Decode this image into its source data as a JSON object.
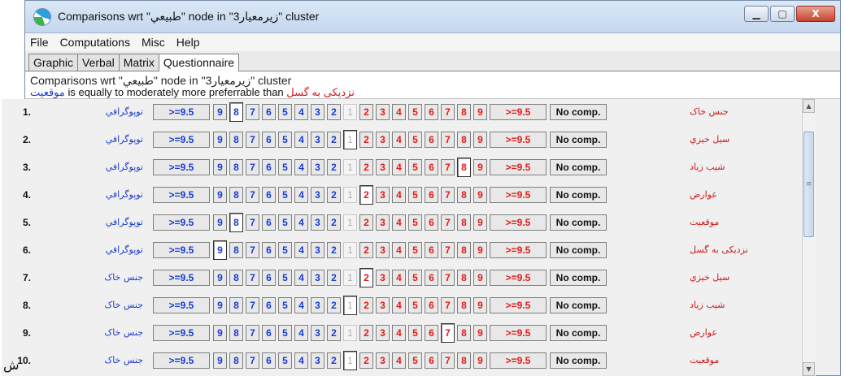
{
  "window": {
    "title": "Comparisons wrt \"طبيعي\" node in \"زيرمعيار3\" cluster",
    "buttons": {
      "minimize": "▁",
      "maximize": "▢",
      "close": "X"
    }
  },
  "menu": [
    "File",
    "Computations",
    "Misc",
    "Help"
  ],
  "tabs": [
    {
      "label": "Graphic",
      "active": false
    },
    {
      "label": "Verbal",
      "active": false
    },
    {
      "label": "Matrix",
      "active": false
    },
    {
      "label": "Questionnaire",
      "active": true
    }
  ],
  "header": {
    "line1": "Comparisons wrt \"طبيعي\" node in \"زيرمعيار3\" cluster",
    "line2_left_node": "موقعيت",
    "line2_mid": " is equally to moderately more preferrable than ",
    "line2_right_node": "نزديکی به گسل"
  },
  "scale": {
    "left": [
      ">=9.5",
      "9",
      "8",
      "7",
      "6",
      "5",
      "4",
      "3",
      "2"
    ],
    "center": "1",
    "right": [
      "2",
      "3",
      "4",
      "5",
      "6",
      "7",
      "8",
      "9",
      ">=9.5"
    ],
    "no_comp": "No comp."
  },
  "rows": [
    {
      "num": "1.",
      "left": "توپوگرافي",
      "right": "جنس خاک",
      "selected": "L:8"
    },
    {
      "num": "2.",
      "left": "توپوگرافي",
      "right": "سيل خيزي",
      "selected": "C"
    },
    {
      "num": "3.",
      "left": "توپوگرافي",
      "right": "شيب زياد",
      "selected": "R:8"
    },
    {
      "num": "4.",
      "left": "توپوگرافي",
      "right": "عوارض",
      "selected": "R:2"
    },
    {
      "num": "5.",
      "left": "توپوگرافي",
      "right": "موقعيت",
      "selected": "L:8"
    },
    {
      "num": "6.",
      "left": "توپوگرافي",
      "right": "نزديکی به گسل",
      "selected": "L:9"
    },
    {
      "num": "7.",
      "left": "جنس خاک",
      "right": "سيل خيزي",
      "selected": "R:2"
    },
    {
      "num": "8.",
      "left": "جنس خاک",
      "right": "شيب زياد",
      "selected": "C"
    },
    {
      "num": "9.",
      "left": "جنس خاک",
      "right": "عوارض",
      "selected": "R:7"
    },
    {
      "num": "10.",
      "left": "جنس خاک",
      "right": "موقعيت",
      "selected": "C"
    }
  ],
  "scrollbar": {
    "up": "▲",
    "down": "▼",
    "grip": "≡"
  },
  "stray_char": "ش"
}
